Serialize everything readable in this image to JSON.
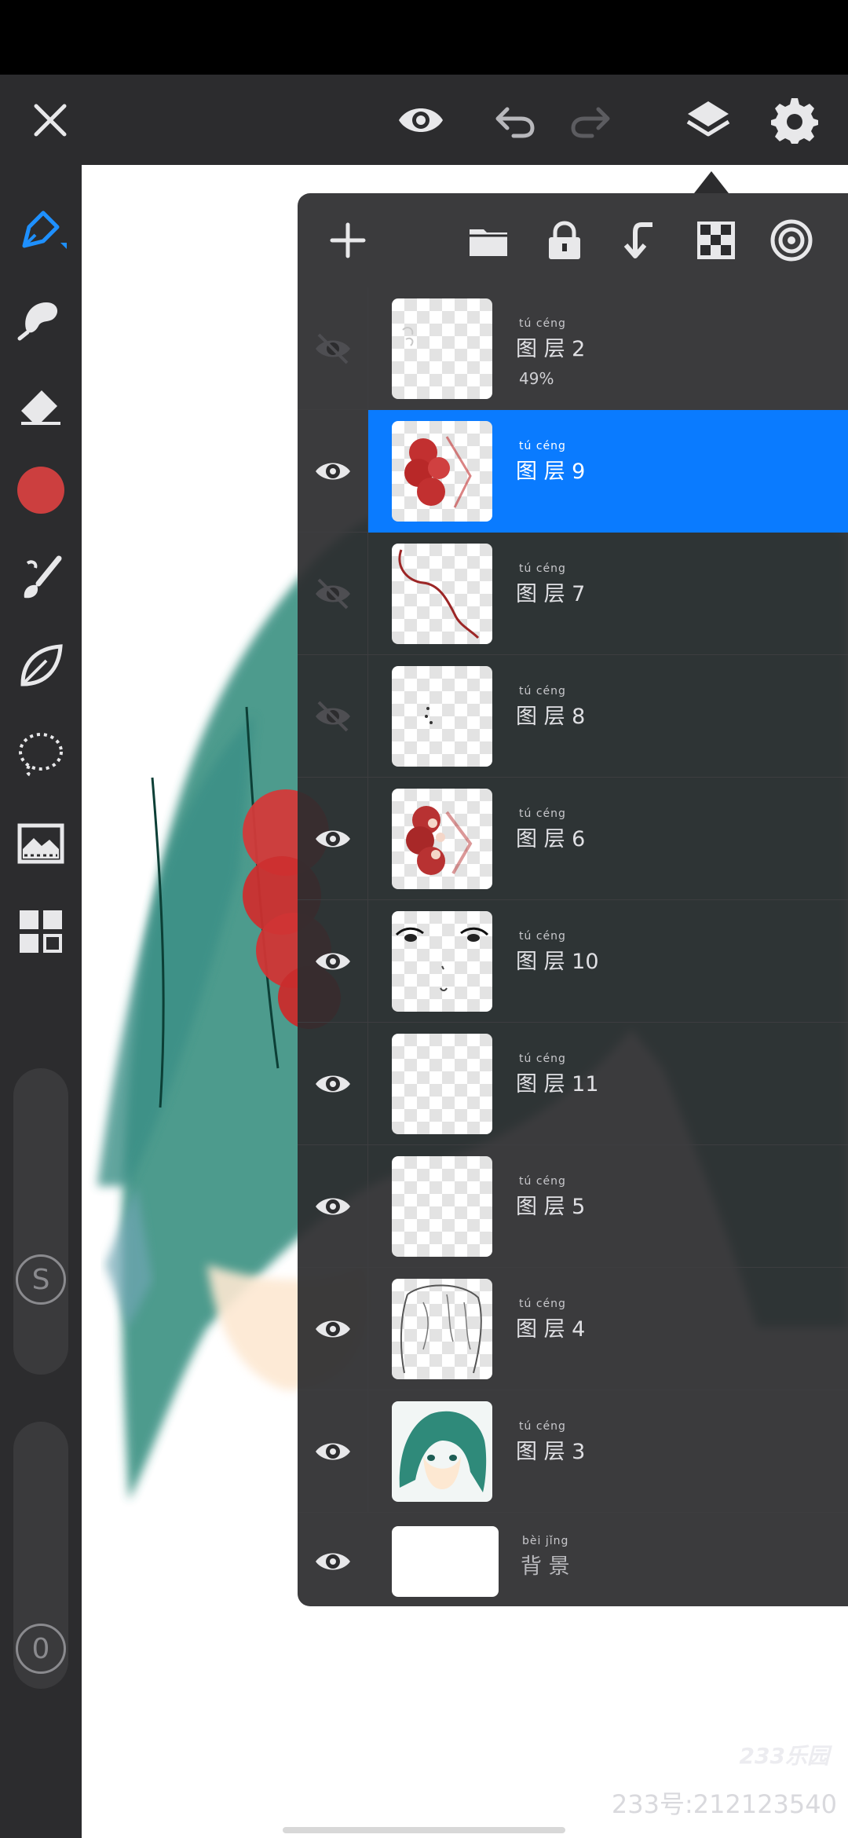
{
  "colors": {
    "accent": "#0a7bff",
    "brush_color": "#cc3f3f",
    "panel": "#2c2c2e"
  },
  "topbar": {
    "icons": [
      "close-icon",
      "eye-icon",
      "undo-icon",
      "redo-icon",
      "layers-icon",
      "gear-icon"
    ]
  },
  "sidebar": {
    "tools": [
      "pen-icon",
      "smudge-icon",
      "eraser-icon",
      "color-swatch",
      "brush-icon",
      "leaf-icon",
      "lasso-icon",
      "image-icon",
      "grid-icon"
    ],
    "size_label": "S",
    "opacity_label": "0"
  },
  "layer_panel": {
    "toolbar_icons": [
      "plus-icon",
      "folder-icon",
      "lock-icon",
      "merge-down-icon",
      "checkerboard-icon",
      "blend-icon"
    ],
    "layers": [
      {
        "ruby": "tú céng",
        "name": "图 层 2",
        "opacity": "49%",
        "visible": false,
        "selected": false
      },
      {
        "ruby": "tú céng",
        "name": "图 层 9",
        "visible": true,
        "selected": true
      },
      {
        "ruby": "tú céng",
        "name": "图 层 7",
        "visible": false,
        "selected": false
      },
      {
        "ruby": "tú céng",
        "name": "图 层 8",
        "visible": false,
        "selected": false
      },
      {
        "ruby": "tú céng",
        "name": "图 层 6",
        "visible": true,
        "selected": false
      },
      {
        "ruby": "tú céng",
        "name": "图 层 10",
        "visible": true,
        "selected": false
      },
      {
        "ruby": "tú céng",
        "name": "图 层 11",
        "visible": true,
        "selected": false
      },
      {
        "ruby": "tú céng",
        "name": "图 层 5",
        "visible": true,
        "selected": false
      },
      {
        "ruby": "tú céng",
        "name": "图 层 4",
        "visible": true,
        "selected": false
      },
      {
        "ruby": "tú céng",
        "name": "图 层 3",
        "visible": true,
        "selected": false
      }
    ],
    "background": {
      "ruby": "bèi jǐng",
      "name": "背 景",
      "visible": true
    }
  },
  "watermark": {
    "logo": "233乐园",
    "text": "233号:212123540"
  }
}
